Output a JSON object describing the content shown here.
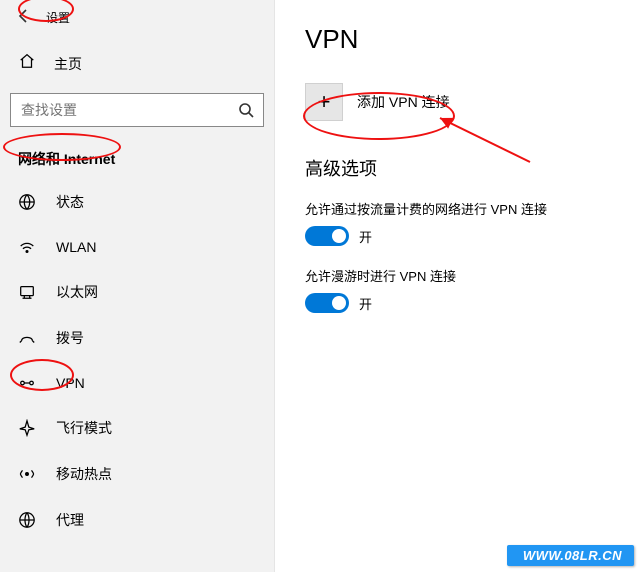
{
  "titlebar": {
    "app_title": "设置"
  },
  "sidebar": {
    "home_label": "主页",
    "search_placeholder": "查找设置",
    "section_header": "网络和 Internet",
    "items": [
      {
        "label": "状态"
      },
      {
        "label": "WLAN"
      },
      {
        "label": "以太网"
      },
      {
        "label": "拨号"
      },
      {
        "label": "VPN"
      },
      {
        "label": "飞行模式"
      },
      {
        "label": "移动热点"
      },
      {
        "label": "代理"
      }
    ]
  },
  "main": {
    "heading": "VPN",
    "add_label": "添加 VPN 连接",
    "advanced_heading": "高级选项",
    "options": [
      {
        "label": "允许通过按流量计费的网络进行 VPN 连接",
        "state": "开"
      },
      {
        "label": "允许漫游时进行 VPN 连接",
        "state": "开"
      }
    ]
  },
  "watermark": "WWW.08LR.CN"
}
